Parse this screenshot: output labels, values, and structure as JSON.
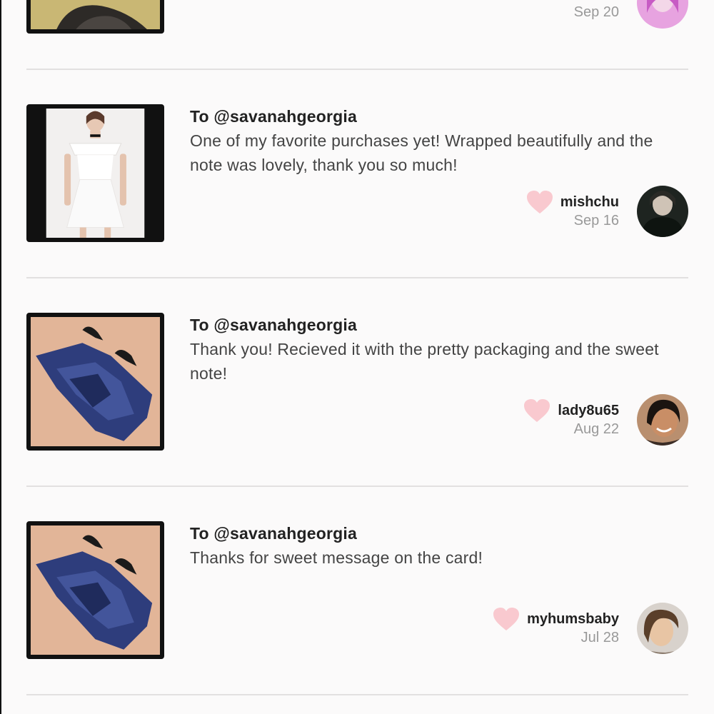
{
  "reviews": [
    {
      "to": "",
      "text": "",
      "username": "",
      "date": "Sep 20",
      "image": "leather-item-on-yellow-photo",
      "avatar": "pink-hair-avatar"
    },
    {
      "to": "To @savanahgeorgia",
      "text": "One of my favorite purchases yet! Wrapped beautifully and the note was lovely, thank you so much!",
      "username": "mishchu",
      "date": "Sep 16",
      "image": "white-off-shoulder-dress-photo",
      "avatar": "dark-scarf-avatar"
    },
    {
      "to": "To @savanahgeorgia",
      "text": "Thank you! Recieved it with the pretty packaging and the sweet note!",
      "username": "lady8u65",
      "date": "Aug 22",
      "image": "blue-satin-dress-photo",
      "avatar": "smiling-woman-avatar"
    },
    {
      "to": "To @savanahgeorgia",
      "text": "Thanks for sweet message on the card!",
      "username": "myhumsbaby",
      "date": "Jul 28",
      "image": "blue-satin-dress-photo",
      "avatar": "selfie-avatar"
    }
  ],
  "colors": {
    "background": "#fbfafa",
    "heart": "#f9c9cf",
    "divider": "#e2e0e0",
    "date": "#999999",
    "text": "#444444"
  }
}
